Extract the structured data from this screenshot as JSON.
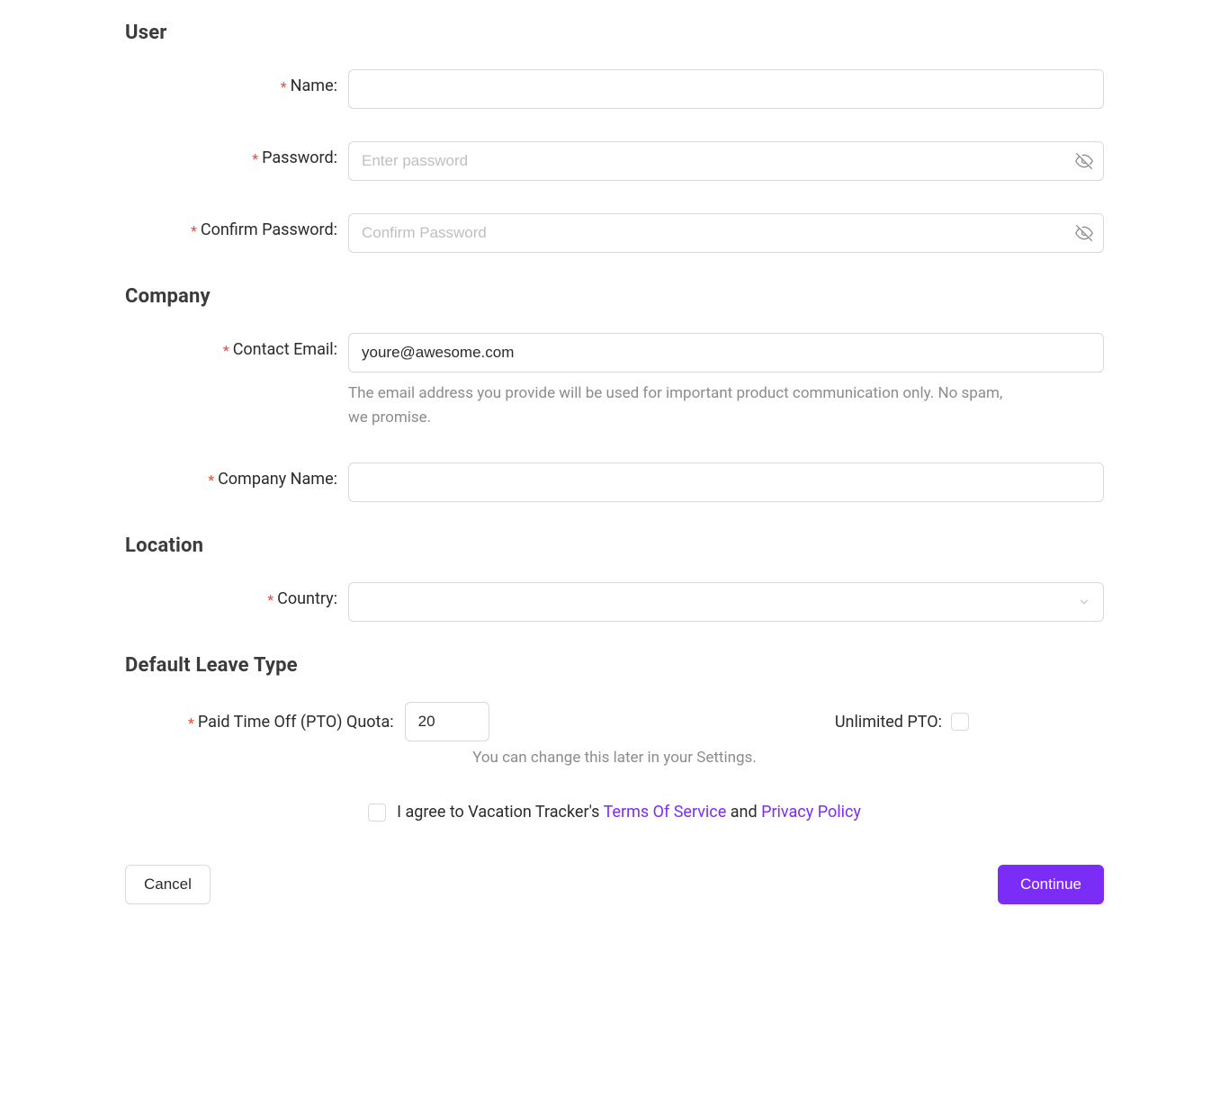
{
  "sections": {
    "user": "User",
    "company": "Company",
    "location": "Location",
    "leave": "Default Leave Type"
  },
  "labels": {
    "name": "Name",
    "password": "Password",
    "confirmPassword": "Confirm Password",
    "contactEmail": "Contact Email",
    "companyName": "Company Name",
    "country": "Country",
    "ptoQuota": "Paid Time Off (PTO) Quota",
    "unlimitedPto": "Unlimited PTO"
  },
  "placeholders": {
    "password": "Enter password",
    "confirmPassword": "Confirm Password"
  },
  "values": {
    "name": "",
    "contactEmail": "youre@awesome.com",
    "companyName": "",
    "ptoQuota": "20"
  },
  "help": {
    "contactEmail": "The email address you provide will be used for important product communication only. No spam, we promise.",
    "pto": "You can change this later in your Settings."
  },
  "agree": {
    "prefix": "I agree to Vacation Tracker's ",
    "tos": "Terms Of Service",
    "mid": " and ",
    "privacy": "Privacy Policy"
  },
  "buttons": {
    "cancel": "Cancel",
    "continue": "Continue"
  },
  "punct": {
    "colon": ":"
  }
}
